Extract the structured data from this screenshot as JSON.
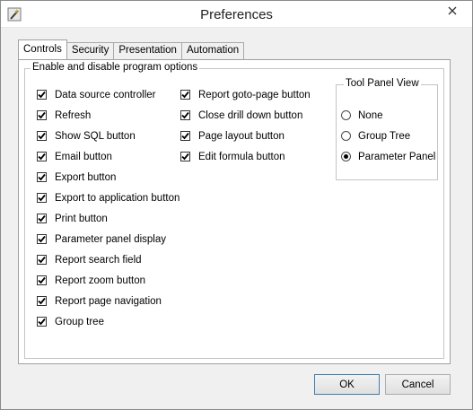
{
  "window": {
    "title": "Preferences",
    "icons": {
      "app": "wand-icon",
      "close": "close-icon"
    }
  },
  "tabs": [
    {
      "label": "Controls",
      "active": true
    },
    {
      "label": "Security",
      "active": false
    },
    {
      "label": "Presentation",
      "active": false
    },
    {
      "label": "Automation",
      "active": false
    }
  ],
  "options_group": {
    "legend": "Enable and disable program options",
    "column1": [
      {
        "label": "Data source controller",
        "checked": true
      },
      {
        "label": "Refresh",
        "checked": true
      },
      {
        "label": "Show SQL button",
        "checked": true
      },
      {
        "label": "Email button",
        "checked": true
      },
      {
        "label": "Export button",
        "checked": true
      },
      {
        "label": "Export to application button",
        "checked": true
      },
      {
        "label": "Print button",
        "checked": true
      },
      {
        "label": "Parameter panel display",
        "checked": true
      },
      {
        "label": "Report search field",
        "checked": true
      },
      {
        "label": "Report zoom button",
        "checked": true
      },
      {
        "label": "Report page navigation",
        "checked": true
      },
      {
        "label": "Group tree",
        "checked": true
      }
    ],
    "column2": [
      {
        "label": "Report goto-page button",
        "checked": true
      },
      {
        "label": "Close drill down button",
        "checked": true
      },
      {
        "label": "Page layout button",
        "checked": true
      },
      {
        "label": "Edit formula button",
        "checked": true
      }
    ]
  },
  "tool_panel": {
    "legend": "Tool Panel View",
    "options": [
      {
        "label": "None",
        "selected": false
      },
      {
        "label": "Group Tree",
        "selected": false
      },
      {
        "label": "Parameter Panel",
        "selected": true
      }
    ]
  },
  "buttons": {
    "ok": "OK",
    "cancel": "Cancel"
  }
}
